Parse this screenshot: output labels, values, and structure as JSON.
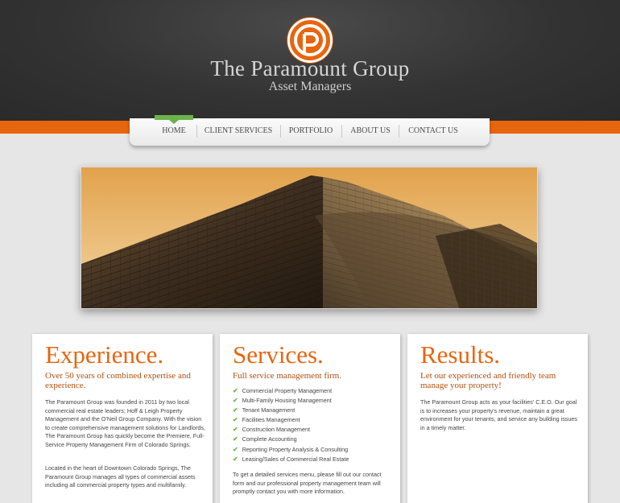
{
  "brand": {
    "name": "The Paramount Group",
    "subtitle": "Asset Managers",
    "logo_letter": "P",
    "accent_color": "#e8650f",
    "nav_indicator_color": "#6cb34a"
  },
  "nav": {
    "items": [
      {
        "label": "HOME",
        "active": true
      },
      {
        "label": "CLIENT SERVICES"
      },
      {
        "label": "PORTFOLIO"
      },
      {
        "label": "ABOUT US"
      },
      {
        "label": "CONTACT US"
      }
    ]
  },
  "hero": {
    "image": "office-tower-photo"
  },
  "columns": [
    {
      "heading": "Experience.",
      "subheading": "Over 50 years of combined expertise and experience.",
      "paragraphs": [
        "The Paramount Group was founded in 2011 by two local commercial real estate leaders; Hoff & Leigh Property Management and the O'Neil Group Company. With the vision to create comprehensive management solutions for Landlords, The Paramount Group has quickly become the Premiere, Full-Service Property Management Firm of Colorado Springs.",
        "Located in the heart of Downtown Colorado Springs, The Paramount Group manages all types of commercial assets including all commercial property types and multifamily."
      ]
    },
    {
      "heading": "Services.",
      "subheading": "Full service management firm.",
      "list": [
        "Commercial Property Management",
        "Multi-Family Housing Management",
        "Tenant Management",
        "Facilities Management",
        "Construction Management",
        "Complete Accounting",
        "Reporting Property Analysis & Consulting",
        "Leasing/Sales of Commercial Real Estate"
      ],
      "paragraph": "To get a detailed services menu, please fill out our contact form and our professional property management team will promptly contact you with more information."
    },
    {
      "heading": "Results.",
      "subheading": "Let our experienced and friendly team manage your property!",
      "paragraphs": [
        "The Paramount Group acts as your facilities' C.E.O. Our goal is to increases your property's revenue, maintain a great environment for your tenants, and service any building issues in a timely matter."
      ]
    }
  ]
}
